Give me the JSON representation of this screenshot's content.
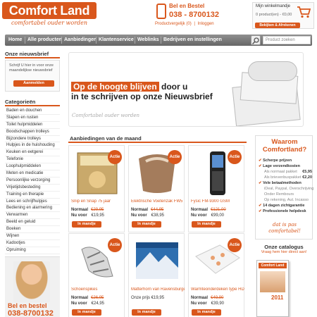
{
  "header": {
    "logo": "Comfort Land",
    "tagline": "comfortabel ouder worden",
    "phone_label": "Bel en Bestel",
    "phone_number": "038 - 8700132",
    "links": [
      "Productvergelijk (0)",
      "|",
      "Inloggen"
    ]
  },
  "cart": {
    "title": "Mijn winkelmandje",
    "info": "0 product(en) - €0,00",
    "button": "Bekijken & Afrekenen"
  },
  "nav": {
    "items": [
      "Home",
      "Alle producten",
      "Aanbiedingen",
      "Klantenservice",
      "Weblinks",
      "Bedrijven en instellingen"
    ],
    "search_placeholder": "Product zoeken"
  },
  "newsletter": {
    "title": "Onze nieuwsbrief",
    "text": "Schrijf U hier in voor onze maandelijkse nieuwsbrief",
    "button": "Aanmelden"
  },
  "categories": {
    "title": "Categorieën",
    "items": [
      "Baden en douchen",
      "Slapen en rusten",
      "Toilet hulpmiddelen",
      "Boodschappen trolleys",
      "Bijzondere trolleys",
      "Hulpjes in de huishouding",
      "Keuken en eetgerei",
      "Telefonie",
      "Loophulpmiddelen",
      "Meten en medicatie",
      "Persoonlijke verzorging",
      "Vrijetijdsbesteding",
      "Training en therapie",
      "Lees en schrijfhulpjes",
      "Bediening en alarmering",
      "Verwarmen",
      "Beeld en geluid",
      "Boeken",
      "Wijnen",
      "Kadootjes",
      "Opruiming"
    ]
  },
  "contact": {
    "line1": "Bel en bestel",
    "line2": "038-8700132"
  },
  "banner": {
    "highlight": "Op de hoogte blijven",
    "line1_rest": " door u",
    "line2": "in te schrijven op onze Nieuwsbrief",
    "logo": "Comfortabel ouder worden"
  },
  "offers": {
    "title": "Aanbiedingen van de maand",
    "badge": "Actie",
    "normaal": "Normaal",
    "nu": "Nu voor",
    "onze_prijs": "Onze prijs",
    "button": "In mandje",
    "products": [
      {
        "name": "Snip en Snap 75 jaar",
        "old": "€29,95",
        "new": "€19,95",
        "img": "box"
      },
      {
        "name": "Elektrische Voetenzak FW5",
        "old": "€44,95",
        "new": "€38,95",
        "img": "footwarmer"
      },
      {
        "name": "Fysic FM-9300 GSM",
        "old": "€121,00",
        "new": "€99,00",
        "img": "phone"
      },
      {
        "name": "Schoenspikes",
        "old": "€26,95",
        "new": "€24,95",
        "img": "spikes"
      },
      {
        "name": "Matterhorn van Ravensburger",
        "price": "€19,95",
        "img": "puzzle"
      },
      {
        "name": "Warmteonderdeken type HDP",
        "old": "€49,90",
        "new": "€39,90",
        "img": "blanket"
      }
    ]
  },
  "waarom": {
    "title": "Waarom Comfortland?",
    "items": [
      {
        "t": "main",
        "label": "Scherpe prijzen"
      },
      {
        "t": "main",
        "label": "Lage verzendkosten"
      },
      {
        "t": "sub",
        "label": "Als normaal pakket",
        "value": "€5,95"
      },
      {
        "t": "sub",
        "label": "Als brievenbuspakket",
        "value": "€2,20"
      },
      {
        "t": "main",
        "label": "Vele betaalmethoden"
      },
      {
        "t": "sub",
        "label": "iDeal, Paypal, Overschrijving"
      },
      {
        "t": "sub",
        "label": "Onder Rembours"
      },
      {
        "t": "sub",
        "label": "Op rekening, Aut. Incasso"
      },
      {
        "t": "main",
        "label": "14 dagen zichtgarantie"
      },
      {
        "t": "main",
        "label": "Professionele helpdesk"
      }
    ],
    "footer1": "dat is pas",
    "footer2": "comfortabel!"
  },
  "catalog": {
    "title": "Onze catalogus",
    "subtitle": "Vraag hem hier direct aan!",
    "logo": "Comfort Land",
    "year": "2011"
  },
  "colors": {
    "accent": "#d9571c",
    "nav": "#777777"
  }
}
